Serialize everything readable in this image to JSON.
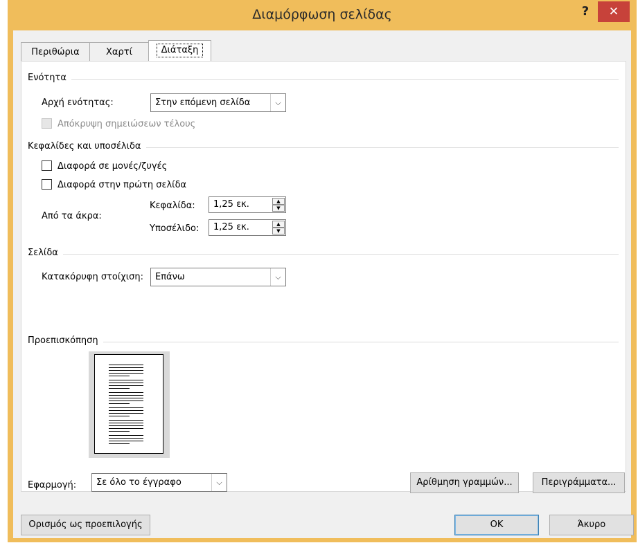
{
  "window": {
    "title": "Διαμόρφωση σελίδας",
    "help_glyph": "?",
    "close_glyph": "✕"
  },
  "tabs": [
    {
      "label": "Περιθώρια"
    },
    {
      "label": "Χαρτί"
    },
    {
      "label": "Διάταξη"
    }
  ],
  "section": {
    "title": "Ενότητα",
    "start_label": "Αρχή ενότητας:",
    "start_value": "Στην επόμενη σελίδα",
    "suppress_endnotes_label": "Απόκρυψη σημειώσεων τέλους"
  },
  "headers_footers": {
    "title": "Κεφαλίδες και υποσέλιδα",
    "odd_even_label": "Διαφορά σε μονές/ζυγές",
    "first_page_label": "Διαφορά στην πρώτη σελίδα",
    "from_edge_label": "Από τα άκρα:",
    "header_label": "Κεφαλίδα:",
    "header_value": "1,25 εκ.",
    "footer_label": "Υποσέλιδο:",
    "footer_value": "1,25 εκ."
  },
  "page": {
    "title": "Σελίδα",
    "vertical_alignment_label": "Κατακόρυφη στοίχιση:",
    "vertical_alignment_value": "Επάνω"
  },
  "preview": {
    "title": "Προεπισκόπηση"
  },
  "apply": {
    "label": "Εφαρμογή:",
    "value": "Σε όλο το έγγραφο"
  },
  "buttons": {
    "line_numbers": "Αρίθμηση γραμμών...",
    "borders": "Περιγράμματα...",
    "set_default": "Ορισμός ως προεπιλογής",
    "ok": "OK",
    "cancel": "Άκυρο"
  },
  "icons": {
    "dropdown": "chevron-down-icon",
    "spin_up": "triangle-up-icon",
    "spin_down": "triangle-down-icon",
    "close": "close-icon",
    "help": "help-icon"
  },
  "colors": {
    "title_bar": "#f0bd5b",
    "close_button": "#c7423a",
    "dialog_bg": "#f0f0f0",
    "panel_bg": "#ffffff"
  }
}
